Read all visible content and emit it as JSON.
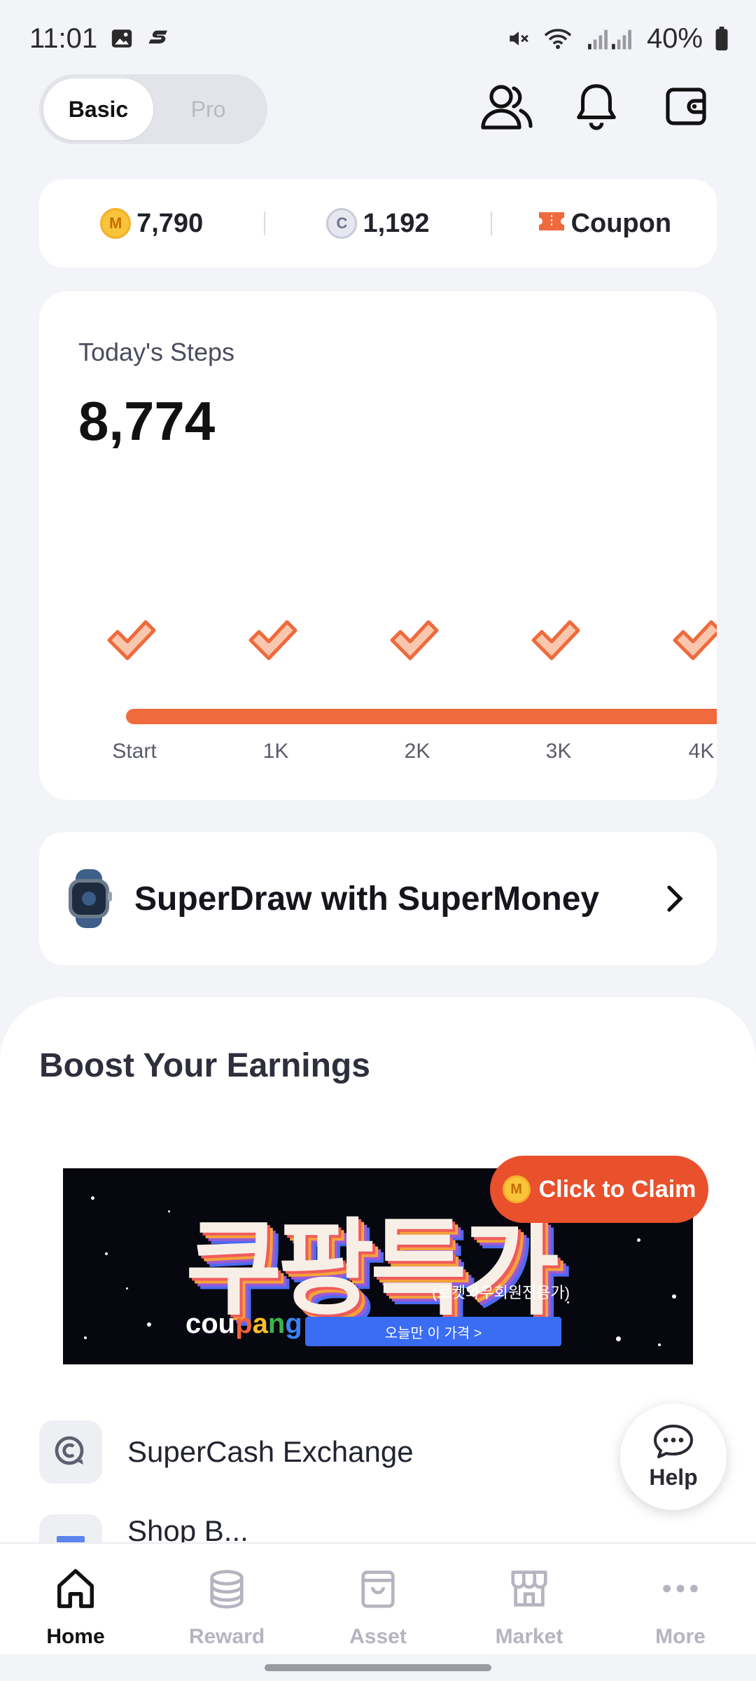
{
  "status_bar": {
    "time": "11:01",
    "battery": "40%",
    "icons": [
      "gallery-icon",
      "s-app-icon",
      "mute-icon",
      "wifi-icon",
      "signal-icon",
      "battery-icon"
    ]
  },
  "mode_toggle": {
    "options": [
      "Basic",
      "Pro"
    ],
    "selected": "Basic"
  },
  "top_icons": [
    "friends-icon",
    "bell-icon",
    "wallet-icon"
  ],
  "balance": {
    "m_coins": "7,790",
    "c_coins": "1,192",
    "coupon_label": "Coupon",
    "coin_m_letter": "M",
    "coin_c_letter": "C"
  },
  "steps": {
    "label": "Today's Steps",
    "value": "8,774",
    "milestones": [
      "Start",
      "1K",
      "2K",
      "3K",
      "4K"
    ]
  },
  "superdraw": {
    "title": "SuperDraw with SuperMoney"
  },
  "boost": {
    "title": "Boost Your Earnings",
    "banner": {
      "headline": "쿠팡특가",
      "subtitle": "(로켓와우회원전용가)",
      "logo": [
        "cou",
        "p",
        "a",
        "n",
        "g"
      ],
      "button": "오늘만 이 가격 >"
    },
    "claim_button": "Click to Claim",
    "claim_coin": "M",
    "items": [
      {
        "label": "SuperCash Exchange",
        "icon": "supercash-icon"
      },
      {
        "label": "Shop B...",
        "icon": "gift-icon"
      }
    ]
  },
  "help": {
    "label": "Help"
  },
  "nav": {
    "items": [
      {
        "label": "Home",
        "icon": "home-icon",
        "active": true
      },
      {
        "label": "Reward",
        "icon": "coins-icon",
        "active": false
      },
      {
        "label": "Asset",
        "icon": "bag-icon",
        "active": false
      },
      {
        "label": "Market",
        "icon": "store-icon",
        "active": false
      },
      {
        "label": "More",
        "icon": "more-icon",
        "active": false
      }
    ]
  },
  "colors": {
    "accent": "#ef6a3c",
    "claim": "#e9502c",
    "background": "#f3f4f7"
  }
}
